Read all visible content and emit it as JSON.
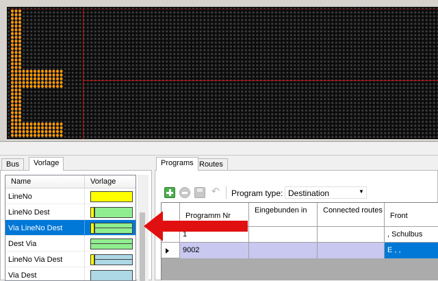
{
  "led_display": {
    "dot_color_on": "#ff9900",
    "dot_color_off": "#3a3a3a",
    "background": "#0b0b0b",
    "zone_border_color": "#b81414",
    "lit_pattern": [
      "111",
      "111",
      "111",
      "111",
      "111",
      "111",
      "111",
      "111",
      "111",
      "111",
      "111",
      "111",
      "111",
      "111",
      "111",
      "111",
      "11111111111111",
      "11111111111111",
      "11111111111111",
      "11111111111111",
      "11111111111111",
      "111",
      "111",
      "111",
      "111",
      "111",
      "111",
      "111",
      "111",
      "111",
      "11111111111111",
      "11111111111111",
      "11111111111111",
      "11111111111111"
    ]
  },
  "left_panel": {
    "tabs": [
      {
        "label": "Bus",
        "active": false
      },
      {
        "label": "Vorlage",
        "active": true
      }
    ],
    "columns": [
      "Name",
      "Vorlage"
    ],
    "rows": [
      {
        "name": "LineNo",
        "swatch": [
          {
            "color": "#ffff00",
            "weight": 1
          }
        ],
        "selected": false
      },
      {
        "name": "LineNo Dest",
        "swatch": [
          {
            "color": "#ffff00",
            "weight": 0.1
          },
          {
            "color": "#90ee90",
            "weight": 0.9
          }
        ],
        "selected": false
      },
      {
        "name": "Via LineNo Dest",
        "swatch": [
          {
            "color": "#ffff00",
            "weight": 0.1
          },
          {
            "color": "#90ee90",
            "weight": 0.9,
            "split": true
          }
        ],
        "selected": true
      },
      {
        "name": "Dest Via",
        "swatch": [
          {
            "color": "#90ee90",
            "weight": 1,
            "split": true
          }
        ],
        "selected": false
      },
      {
        "name": "LineNo Via Dest",
        "swatch": [
          {
            "color": "#ffff00",
            "weight": 0.1
          },
          {
            "color": "#add8e6",
            "weight": 0.9,
            "split": true
          }
        ],
        "selected": false
      },
      {
        "name": "Via Dest",
        "swatch": [
          {
            "color": "#add8e6",
            "weight": 1
          }
        ],
        "selected": false
      }
    ]
  },
  "right_panel": {
    "tabs": [
      {
        "label": "Programs",
        "active": true
      },
      {
        "label": "Routes",
        "active": false
      }
    ],
    "toolbar": {
      "program_type_label": "Program type:",
      "program_type_value": "Destination"
    },
    "columns": [
      {
        "label": "Programm Nr"
      },
      {
        "label": "Eingebunden in"
      },
      {
        "label": "Connected routes"
      },
      {
        "label": "Front"
      }
    ],
    "rows": [
      {
        "program_nr": "1",
        "eingebunden": "",
        "connected": "",
        "front": ", Schulbus",
        "current": false
      },
      {
        "program_nr": "9002",
        "eingebunden": "",
        "connected": "",
        "front": "E , ,",
        "current": true
      }
    ]
  },
  "annotation": {
    "arrow_color": "#e01010"
  }
}
